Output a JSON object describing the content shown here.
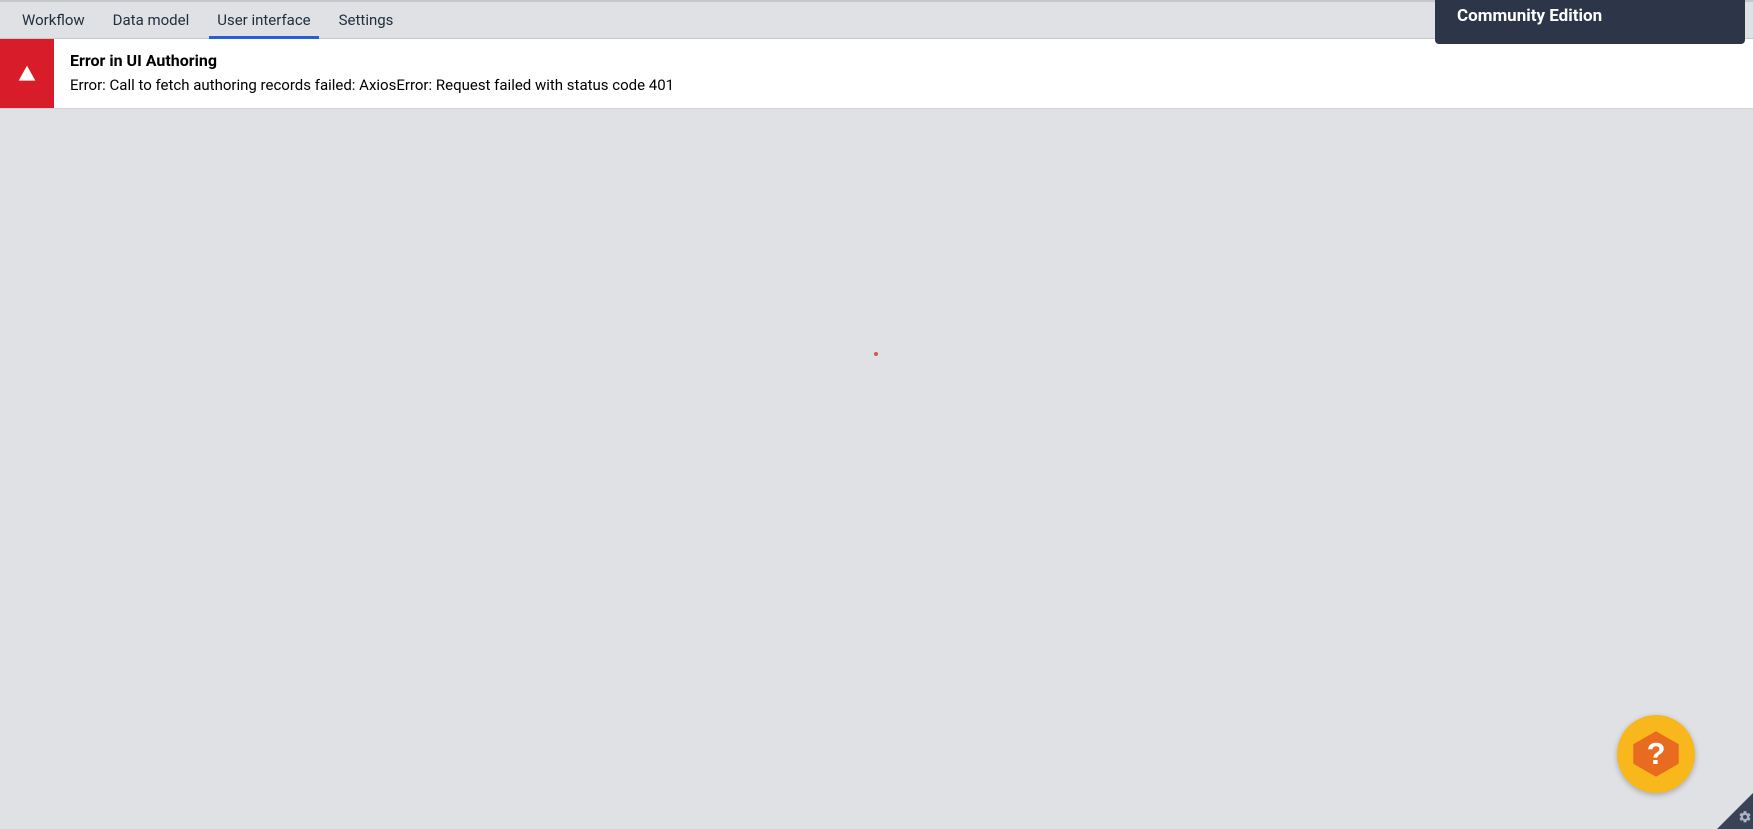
{
  "tabs": {
    "items": [
      {
        "label": "Workflow"
      },
      {
        "label": "Data model"
      },
      {
        "label": "User interface"
      },
      {
        "label": "Settings"
      }
    ],
    "activeIndex": 2
  },
  "banner": {
    "text": "Community Edition"
  },
  "error": {
    "title": "Error in UI Authoring",
    "message": "Error: Call to fetch authoring records failed: AxiosError: Request failed with status code 401"
  }
}
